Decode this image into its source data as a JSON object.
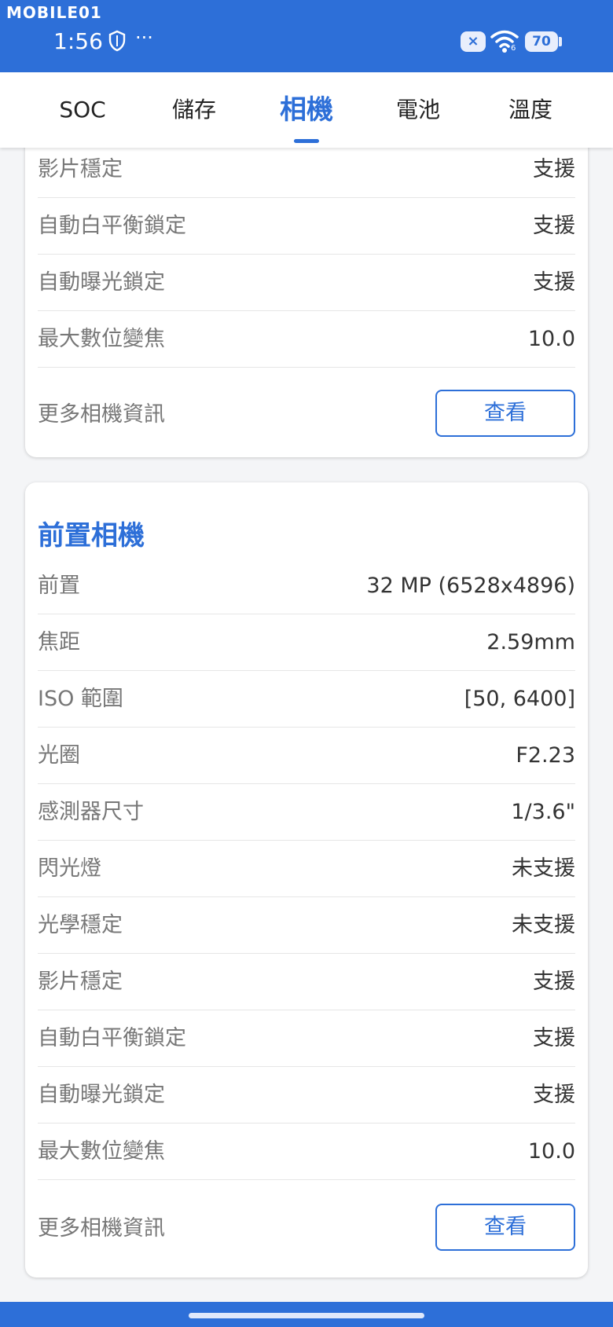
{
  "status_bar": {
    "watermark": "MOBILE01",
    "time": "1:56",
    "more": "···",
    "close_badge": "×",
    "wifi_label": "6",
    "battery": "70"
  },
  "tabs": [
    "SOC",
    "儲存",
    "相機",
    "電池",
    "溫度"
  ],
  "active_tab": "相機",
  "top_card": {
    "rows": [
      {
        "label": "影片穩定",
        "value": "支援"
      },
      {
        "label": "自動白平衡鎖定",
        "value": "支援"
      },
      {
        "label": "自動曝光鎖定",
        "value": "支援"
      },
      {
        "label": "最大數位變焦",
        "value": "10.0"
      }
    ],
    "more_label": "更多相機資訊",
    "button_label": "查看"
  },
  "front_card": {
    "title": "前置相機",
    "rows": [
      {
        "label": "前置",
        "value": "32 MP (6528x4896)"
      },
      {
        "label": "焦距",
        "value": "2.59mm"
      },
      {
        "label": "ISO 範圍",
        "value": "[50, 6400]"
      },
      {
        "label": "光圈",
        "value": "F2.23"
      },
      {
        "label": "感測器尺寸",
        "value": "1/3.6\""
      },
      {
        "label": "閃光燈",
        "value": "未支援"
      },
      {
        "label": "光學穩定",
        "value": "未支援"
      },
      {
        "label": "影片穩定",
        "value": "支援"
      },
      {
        "label": "自動白平衡鎖定",
        "value": "支援"
      },
      {
        "label": "自動曝光鎖定",
        "value": "支援"
      },
      {
        "label": "最大數位變焦",
        "value": "10.0"
      }
    ],
    "more_label": "更多相機資訊",
    "button_label": "查看"
  },
  "colors": {
    "accent": "#2d6fd8",
    "label": "#777777",
    "value": "#333333"
  }
}
